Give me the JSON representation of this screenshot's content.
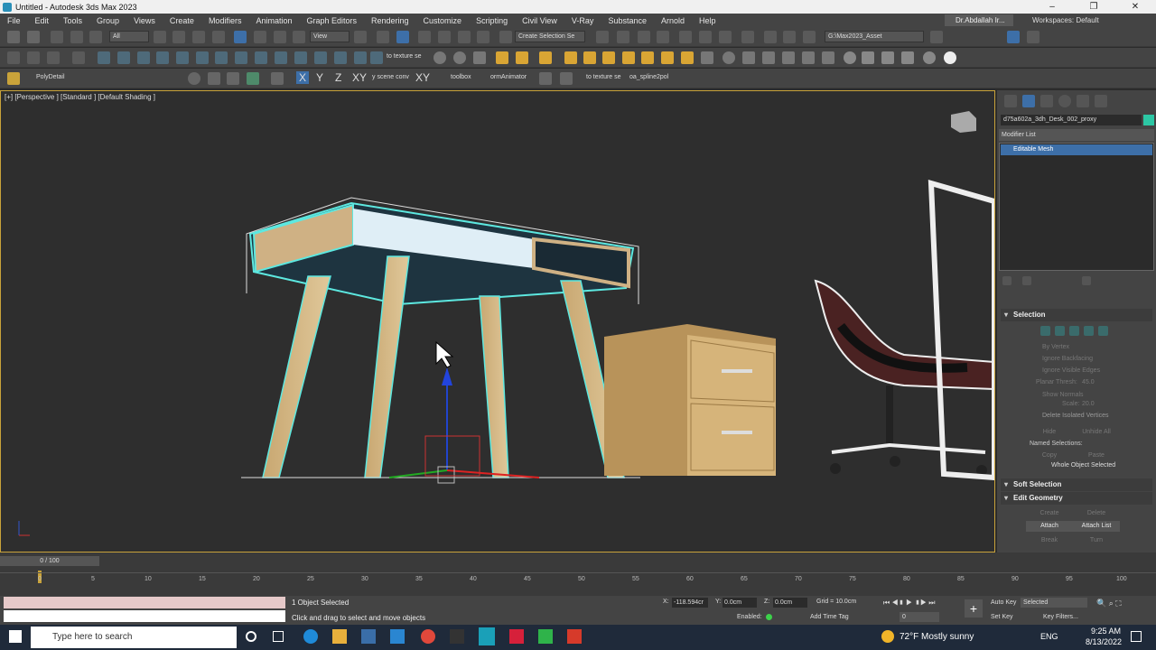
{
  "window": {
    "title": "Untitled - Autodesk 3ds Max 2023"
  },
  "menu": [
    "File",
    "Edit",
    "Tools",
    "Group",
    "Views",
    "Create",
    "Modifiers",
    "Animation",
    "Graph Editors",
    "Rendering",
    "Customize",
    "Scripting",
    "Civil View",
    "V-Ray",
    "Substance",
    "Arnold",
    "Help"
  ],
  "user": "Dr.Abdallah Ir...",
  "workspace": {
    "label": "Workspaces:",
    "value": "Default"
  },
  "toolbar1": {
    "filter": "All",
    "view": "View",
    "selection_set": "Create Selection Se",
    "path": "G:\\Max2023_Asset"
  },
  "toolbar2": {
    "to_texture": "to texture se"
  },
  "toolbar3": {
    "poly_detail": "PolyDetail",
    "x": "X",
    "y": "Y",
    "z": "Z",
    "xy": "XY",
    "scene_conv": "y scene conv",
    "xy2": "XY",
    "toolbox": "toolbox",
    "orm": "ormAnimator",
    "to_texture": "to texture se",
    "spline": "oa_spline2pol"
  },
  "viewport": {
    "label": "[+] [Perspective ] [Standard ] [Default Shading ]"
  },
  "command_panel": {
    "object_name": "d75a602a_3dh_Desk_002_proxy",
    "modifier_list": "Modifier List",
    "stack_item": "Editable Mesh",
    "selection": {
      "title": "Selection",
      "by_vertex": "By Vertex",
      "ignore_backfacing": "Ignore Backfacing",
      "ignore_visible_edges": "Ignore Visible Edges",
      "planar_thresh_label": "Planar Thresh:",
      "planar_thresh_value": "45.0",
      "show_normals": "Show Normals",
      "scale_label": "Scale:",
      "scale_value": "20.0",
      "delete_isolated": "Delete Isolated Vertices",
      "hide": "Hide",
      "unhide_all": "Unhide All",
      "named_selections": "Named Selections:",
      "copy": "Copy",
      "paste": "Paste",
      "status": "Whole Object Selected"
    },
    "soft_selection": "Soft Selection",
    "edit_geometry": {
      "title": "Edit Geometry",
      "create": "Create",
      "delete": "Delete",
      "attach": "Attach",
      "attach_list": "Attach List",
      "break": "Break",
      "turn": "Turn"
    }
  },
  "timeline": {
    "frame": "0 / 100",
    "ticks": [
      "0",
      "5",
      "10",
      "15",
      "20",
      "25",
      "30",
      "35",
      "40",
      "45",
      "50",
      "55",
      "60",
      "65",
      "70",
      "75",
      "80",
      "85",
      "90",
      "95",
      "100"
    ]
  },
  "status": {
    "selected": "1 Object Selected",
    "prompt": "Click and drag to select and move objects",
    "x_label": "X:",
    "x_value": "-118.594cr",
    "y_label": "Y:",
    "y_value": "0.0cm",
    "z_label": "Z:",
    "z_value": "0.0cm",
    "grid": "Grid = 10.0cm",
    "enabled": "Enabled:",
    "add_time_tag": "Add Time Tag",
    "auto_key": "Auto Key",
    "set_key": "Set Key",
    "key_mode": "Selected",
    "key_filters": "Key Filters...",
    "frame_input": "0"
  },
  "taskbar": {
    "search": "Type here to search",
    "weather": "72°F  Mostly sunny",
    "lang": "ENG",
    "time": "9:25 AM",
    "date": "8/13/2022"
  },
  "colors": {
    "accent": "#c9a33a",
    "selection": "#3d6fa8",
    "wire_selected": "#5de8e0"
  }
}
